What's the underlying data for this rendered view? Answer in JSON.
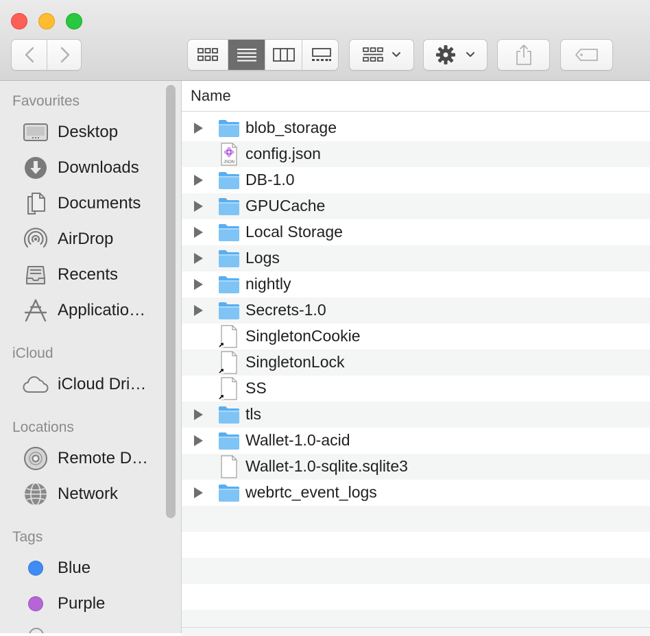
{
  "window": {
    "title": ""
  },
  "toolbar": {
    "back_icon": "chevron-left-icon",
    "forward_icon": "chevron-right-icon",
    "view_modes": [
      "icon-view",
      "list-view",
      "column-view",
      "gallery-view"
    ],
    "active_view": "list-view",
    "group_icon": "group-by-icon",
    "action_icon": "gear-icon",
    "share_icon": "share-icon",
    "tag_icon": "tag-icon"
  },
  "sidebar": {
    "sections": {
      "favourites": "Favourites",
      "icloud": "iCloud",
      "locations": "Locations",
      "tags": "Tags"
    },
    "favourites": [
      {
        "label": "Desktop",
        "icon": "desktop-icon"
      },
      {
        "label": "Downloads",
        "icon": "downloads-icon"
      },
      {
        "label": "Documents",
        "icon": "documents-icon"
      },
      {
        "label": "AirDrop",
        "icon": "airdrop-icon"
      },
      {
        "label": "Recents",
        "icon": "recents-icon"
      },
      {
        "label": "Applicatio…",
        "icon": "applications-icon"
      }
    ],
    "icloud": [
      {
        "label": "iCloud Dri…",
        "icon": "cloud-icon"
      }
    ],
    "locations": [
      {
        "label": "Remote D…",
        "icon": "disc-icon"
      },
      {
        "label": "Network",
        "icon": "network-icon"
      }
    ],
    "tags": [
      {
        "label": "Blue",
        "color": "#3f8cf5"
      },
      {
        "label": "Purple",
        "color": "#b665d9"
      }
    ]
  },
  "list": {
    "column_header": "Name",
    "rows": [
      {
        "name": "blob_storage",
        "type": "folder",
        "expandable": true
      },
      {
        "name": "config.json",
        "type": "json",
        "expandable": false
      },
      {
        "name": "DB-1.0",
        "type": "folder",
        "expandable": true
      },
      {
        "name": "GPUCache",
        "type": "folder",
        "expandable": true
      },
      {
        "name": "Local Storage",
        "type": "folder",
        "expandable": true
      },
      {
        "name": "Logs",
        "type": "folder",
        "expandable": true
      },
      {
        "name": "nightly",
        "type": "folder",
        "expandable": true
      },
      {
        "name": "Secrets-1.0",
        "type": "folder",
        "expandable": true
      },
      {
        "name": "SingletonCookie",
        "type": "alias",
        "expandable": false
      },
      {
        "name": "SingletonLock",
        "type": "alias",
        "expandable": false
      },
      {
        "name": "SS",
        "type": "alias",
        "expandable": false
      },
      {
        "name": "tls",
        "type": "folder",
        "expandable": true
      },
      {
        "name": "Wallet-1.0-acid",
        "type": "folder",
        "expandable": true
      },
      {
        "name": "Wallet-1.0-sqlite.sqlite3",
        "type": "document",
        "expandable": false
      },
      {
        "name": "webrtc_event_logs",
        "type": "folder",
        "expandable": true
      }
    ]
  },
  "colors": {
    "folder": "#7fc4f5",
    "folder_tab": "#5aaef0",
    "sidebar_bg": "#eaeaea",
    "stripe": "#f4f5f5"
  }
}
